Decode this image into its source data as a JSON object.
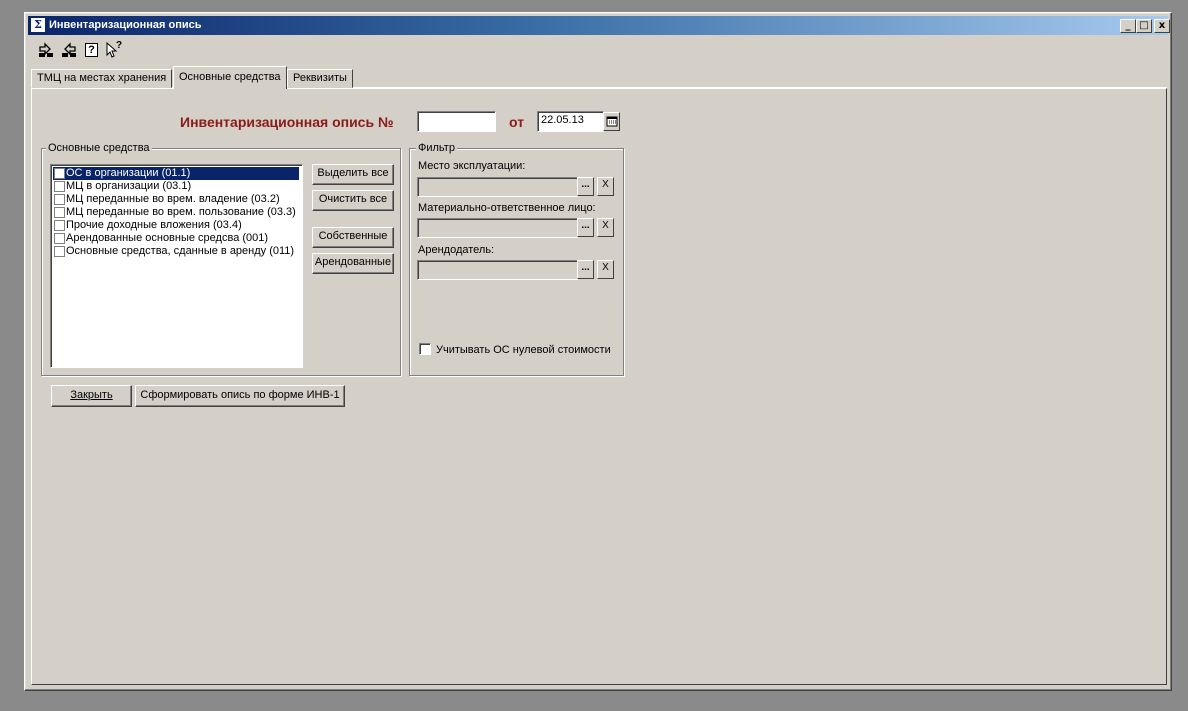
{
  "window": {
    "title": "Инвентаризационная опись",
    "icon": "sigma-icon",
    "caption_buttons": [
      "_",
      "□",
      "x"
    ]
  },
  "toolbar": {
    "icons": [
      "action-icon",
      "action-alt-icon",
      "help-icon",
      "context-help-icon"
    ],
    "help_glyph": "?",
    "context_help_glyph": "?"
  },
  "tabs": [
    {
      "label": "ТМЦ на местах хранения",
      "active": false
    },
    {
      "label": "Основные средства",
      "active": true
    },
    {
      "label": "Реквизиты",
      "active": false
    }
  ],
  "header": {
    "title": "Инвентаризационная опись №",
    "number_value": "",
    "date_label": "от",
    "date_value": "22.05.13"
  },
  "assets_group": {
    "label": "Основные средства",
    "items": [
      {
        "label": "ОС в организации (01.1)",
        "checked": false,
        "selected": true
      },
      {
        "label": "МЦ в организации (03.1)",
        "checked": false,
        "selected": false
      },
      {
        "label": "МЦ переданные во врем. владение (03.2)",
        "checked": false,
        "selected": false
      },
      {
        "label": "МЦ переданные во врем. пользование (03.3)",
        "checked": false,
        "selected": false
      },
      {
        "label": "Прочие доходные вложения (03.4)",
        "checked": false,
        "selected": false
      },
      {
        "label": "Арендованные основные средсва (001)",
        "checked": false,
        "selected": false
      },
      {
        "label": "Основные средства, сданные в аренду (011)",
        "checked": false,
        "selected": false
      }
    ],
    "buttons": {
      "select_all": "Выделить все",
      "clear_all": "Очистить все",
      "own": "Собственные",
      "leased": "Арендованные"
    }
  },
  "filter_group": {
    "label": "Фильтр",
    "fields": [
      {
        "label": "Место эксплуатации:",
        "value": ""
      },
      {
        "label": "Материально-ответственное лицо:",
        "value": ""
      },
      {
        "label": "Арендодатель:",
        "value": ""
      }
    ],
    "select_glyph": "...",
    "clear_glyph": "X",
    "zero_cost_label": "Учитывать ОС нулевой стоимости",
    "zero_cost_checked": false
  },
  "footer": {
    "close": "Закрыть",
    "generate": "Сформировать опись по форме ИНВ-1"
  },
  "colors": {
    "face": "#d4d0c8",
    "title_gradient_start": "#0a246a",
    "title_gradient_end": "#a6caf0",
    "doc_title": "#8b1a1a",
    "selection": "#0a246a"
  }
}
